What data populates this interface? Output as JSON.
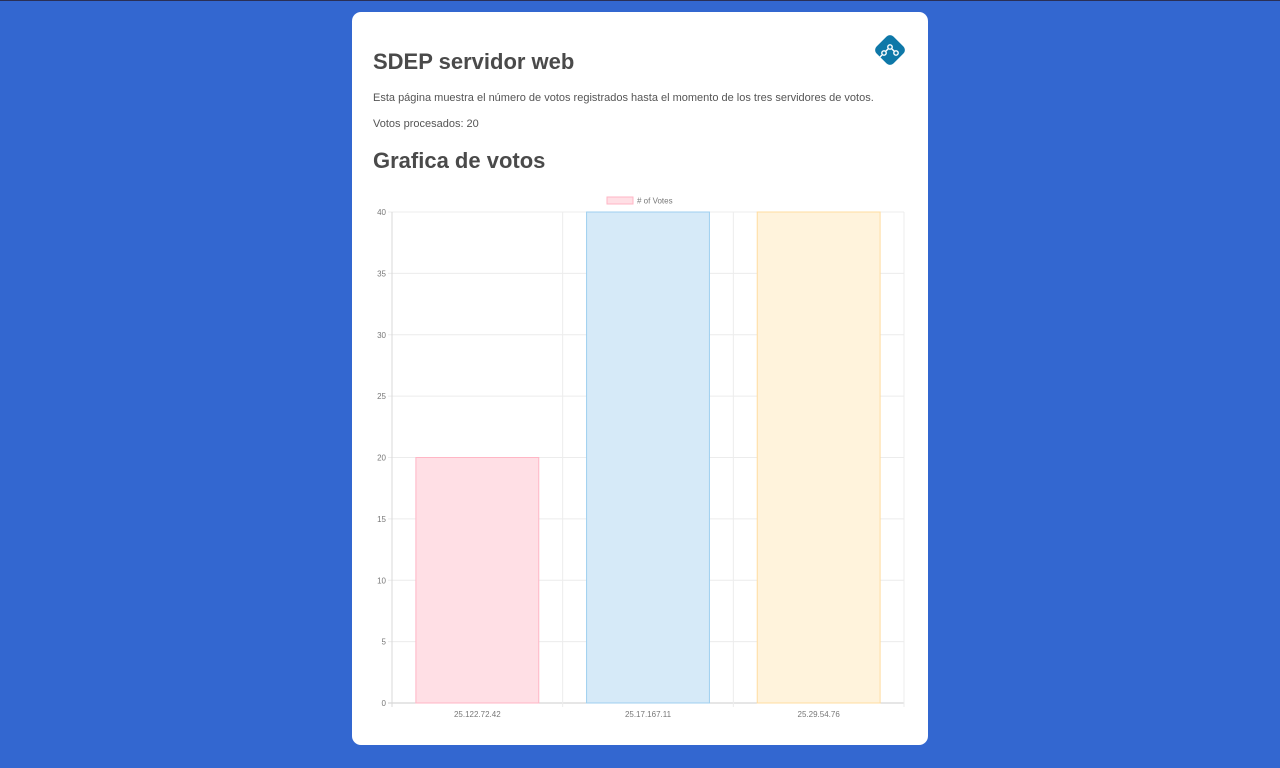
{
  "page": {
    "title": "SDEP servidor web",
    "description": "Esta página muestra el número de votos registrados hasta el momento de los tres servidores de votos.",
    "votes_processed": "Votos procesados: 20",
    "chart_heading": "Grafica de votos",
    "logo_icon": "network-nodes-icon"
  },
  "colors": {
    "background": "#3367d0",
    "card": "#ffffff",
    "logo": "#0e78a8"
  },
  "chart_data": {
    "type": "bar",
    "legend": {
      "label": "# of Votes",
      "position": "top-center"
    },
    "categories": [
      "25.122.72.42",
      "25.17.167.11",
      "25.29.54.76"
    ],
    "series": [
      {
        "name": "# of Votes",
        "values": [
          20,
          40,
          40
        ]
      }
    ],
    "bar_colors": [
      {
        "fill": "#ffdfe5",
        "stroke": "#ffb6c5"
      },
      {
        "fill": "#d6eaf8",
        "stroke": "#9fcfef"
      },
      {
        "fill": "#fff3dc",
        "stroke": "#ffdca0"
      }
    ],
    "ylim": [
      0,
      40
    ],
    "yticks": [
      0,
      5,
      10,
      15,
      20,
      25,
      30,
      35,
      40
    ],
    "grid": true
  }
}
